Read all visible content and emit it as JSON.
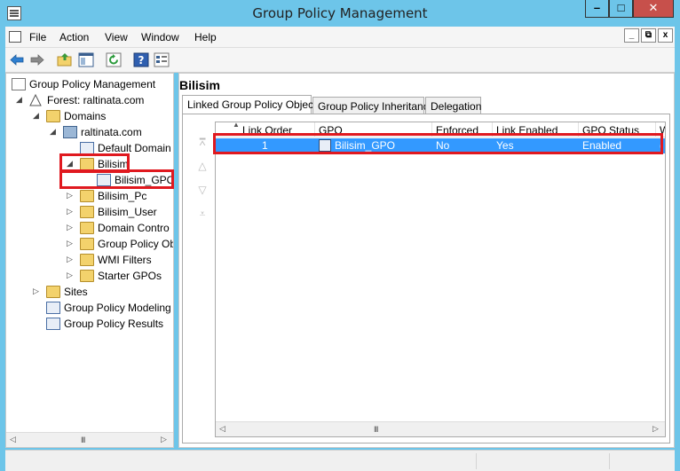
{
  "window": {
    "title": "Group Policy Management"
  },
  "caption_buttons": {
    "minimize": "–",
    "maximize": "□",
    "close": "✕"
  },
  "menu": {
    "items": [
      "File",
      "Action",
      "View",
      "Window",
      "Help"
    ]
  },
  "mdi_buttons": [
    "_",
    "⧉",
    "x"
  ],
  "toolbar": {
    "icons": [
      "back-arrow-icon",
      "forward-arrow-icon",
      "up-folder-icon",
      "show-hide-tree-icon",
      "refresh-icon",
      "help-icon",
      "properties-icon"
    ]
  },
  "tree": {
    "root": "Group Policy Management",
    "forest": "Forest: raltinata.com",
    "domains": "Domains",
    "domain": "raltinata.com",
    "default_domain": "Default Domain",
    "bilisim": "Bilisim",
    "bilisim_gpo": "Bilisim_GPO",
    "bilisim_pc": "Bilisim_Pc",
    "bilisim_user": "Bilisim_User",
    "domain_controllers": "Domain Contro",
    "group_policy_objects": "Group Policy Ob",
    "wmi_filters": "WMI Filters",
    "starter_gpos": "Starter GPOs",
    "sites": "Sites",
    "modeling": "Group Policy Modeling",
    "results": "Group Policy Results"
  },
  "right_pane": {
    "title": "Bilisim",
    "tabs": [
      "Linked Group Policy Objects",
      "Group Policy Inheritance",
      "Delegation"
    ],
    "active_tab": "Linked Group Policy Objects",
    "columns": [
      "Link Order",
      "GPO",
      "Enforced",
      "Link Enabled",
      "GPO Status",
      "W"
    ],
    "rows": [
      {
        "link_order": "1",
        "gpo": "Bilisim_GPO",
        "enforced": "No",
        "link_enabled": "Yes",
        "gpo_status": "Enabled",
        "w": "("
      }
    ]
  },
  "scrollbars": {
    "left_arrow": "◁",
    "right_arrow": "▷",
    "grip": "III"
  },
  "order_buttons": [
    "⩞",
    "△",
    "▽",
    "⩡"
  ],
  "colors": {
    "title_bar": "#6dc5e9",
    "selection": "#3399ff",
    "highlight_box": "#e0191f",
    "close_button": "#c7504b"
  }
}
